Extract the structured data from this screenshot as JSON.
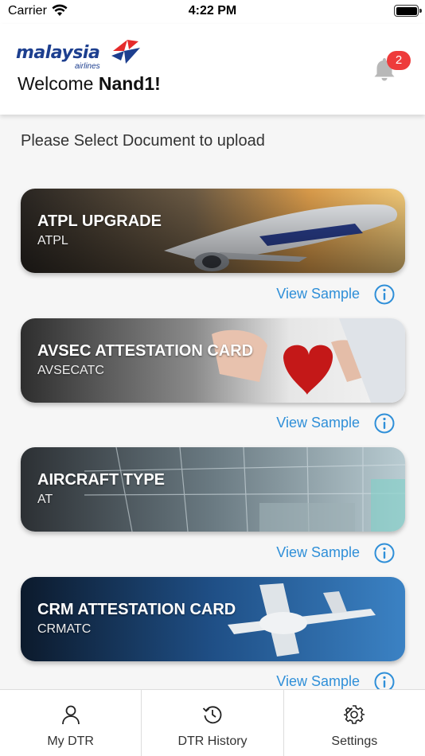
{
  "status_bar": {
    "carrier": "Carrier",
    "time": "4:22 PM"
  },
  "header": {
    "logo_text": "malaysia",
    "logo_sub": "airlines",
    "welcome_prefix": "Welcome ",
    "user_name": "Nand1!",
    "notification_count": "2"
  },
  "prompt": "Please Select Document to upload",
  "documents": [
    {
      "title": "ATPL UPGRADE",
      "code": "ATPL",
      "sample_label": "View Sample"
    },
    {
      "title": "AVSEC ATTESTATION CARD",
      "code": "AVSECATC",
      "sample_label": "View Sample"
    },
    {
      "title": "AIRCRAFT TYPE",
      "code": "AT",
      "sample_label": "View Sample"
    },
    {
      "title": "CRM ATTESTATION CARD",
      "code": "CRMATC",
      "sample_label": "View Sample"
    }
  ],
  "tabs": [
    {
      "label": "My DTR",
      "icon": "person-icon"
    },
    {
      "label": "DTR History",
      "icon": "history-icon"
    },
    {
      "label": "Settings",
      "icon": "gear-icon"
    }
  ],
  "colors": {
    "accent": "#2f8fd8",
    "brand": "#1d3f8f",
    "badge": "#ee3b3b"
  }
}
